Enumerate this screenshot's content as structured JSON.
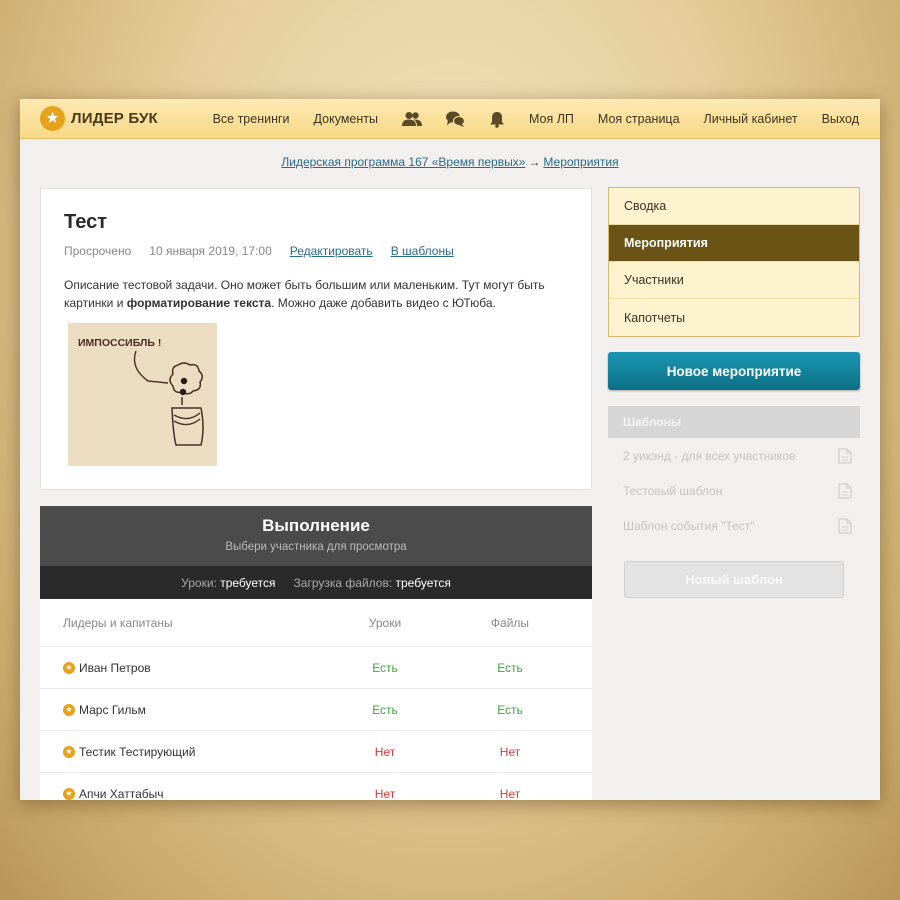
{
  "header": {
    "logo_icon": "star-icon",
    "logo_text": "ЛИДЕР БУК",
    "nav": {
      "trainings": "Все тренинги",
      "documents": "Документы",
      "my_lp": "Моя ЛП",
      "my_page": "Моя страница",
      "cabinet": "Личный кабинет",
      "logout": "Выход"
    },
    "icons": [
      "users-icon",
      "chat-icon",
      "bell-icon"
    ]
  },
  "breadcrumb": {
    "program": "Лидерская программа 167 «Время первых»",
    "separator": "→",
    "current": "Мероприятия"
  },
  "task": {
    "title": "Тест",
    "status": "Просрочено",
    "date": "10 января 2019, 17:00",
    "edit_link": "Редактировать",
    "templates_link": "В шаблоны",
    "description_1": "Описание тестовой задачи. Оно может быть большим или маленьким. Тут могут быть картинки и ",
    "description_bold": "форматирование текста",
    "description_2": ". Можно даже добавить видео с ЮТюба.",
    "image_caption": "ИМПОССИБЛЬ !"
  },
  "execution": {
    "title": "Выполнение",
    "subtitle": "Выбери участника для просмотра",
    "lessons_label": "Уроки:",
    "lessons_value": "требуется",
    "files_label": "Загрузка файлов:",
    "files_value": "требуется",
    "columns": {
      "name": "Лидеры и капитаны",
      "lessons": "Уроки",
      "files": "Файлы"
    },
    "rows": [
      {
        "name": "Иван Петров",
        "lessons": "Есть",
        "files": "Есть"
      },
      {
        "name": "Марс Гильм",
        "lessons": "Есть",
        "files": "Есть"
      },
      {
        "name": "Тестик Тестирующий",
        "lessons": "Нет",
        "files": "Нет"
      },
      {
        "name": "Апчи Хаттабыч",
        "lessons": "Нет",
        "files": "Нет"
      }
    ]
  },
  "sidebar": {
    "items": [
      {
        "label": "Сводка",
        "active": false
      },
      {
        "label": "Мероприятия",
        "active": true
      },
      {
        "label": "Участники",
        "active": false
      },
      {
        "label": "Капотчеты",
        "active": false
      }
    ],
    "new_event_button": "Новое мероприятие",
    "templates_title": "Шаблоны",
    "templates": [
      "2 уикэнд - для всех участников",
      "Тестовый шаблон",
      "Шаблон события \"Тест\""
    ],
    "new_template_button": "Новый шаблон"
  },
  "colors": {
    "accent_gold": "#e6a21a",
    "active_menu": "#6b5315",
    "primary_button": "#0d6f85",
    "yes": "#3da33d",
    "no": "#d63a3a"
  }
}
